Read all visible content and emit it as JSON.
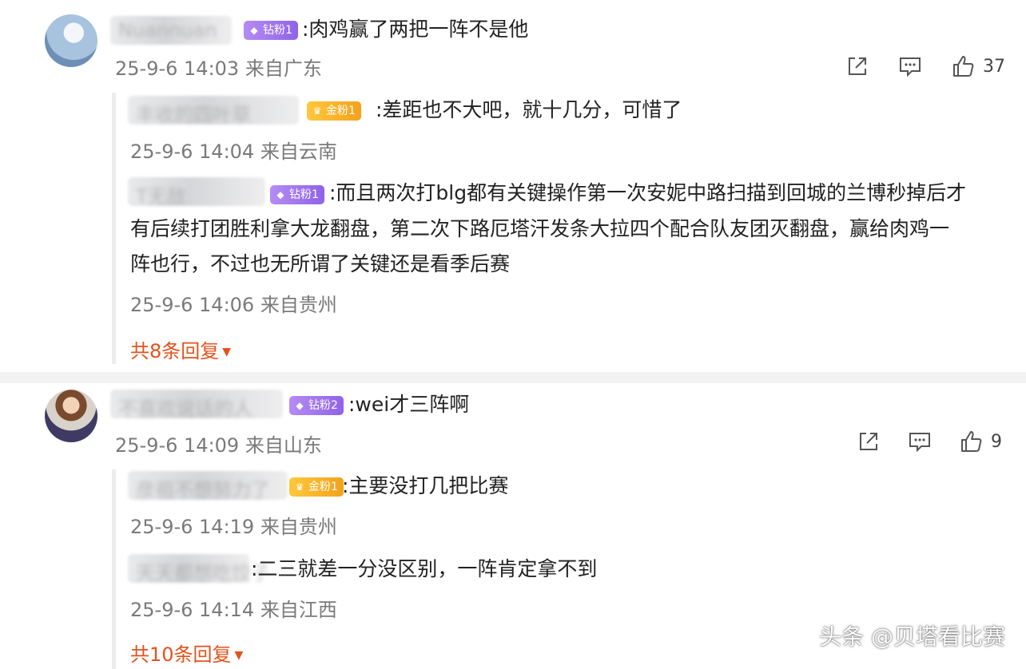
{
  "comments": [
    {
      "username": "Nuannuan",
      "badge": "钻粉1",
      "text": ":肉鸡赢了两把一阵不是他",
      "meta": "25-9-6 14:03 来自广东",
      "likes": "37",
      "replies": [
        {
          "username": "丰收的四叶草",
          "badge": "金粉1",
          "text": ":差距也不大吧，就十几分，可惜了",
          "meta": "25-9-6 14:04 来自云南"
        },
        {
          "username": "T无敌",
          "badge": "钻粉1",
          "text_lines": [
            ":而且两次打blg都有关键操作第一次安妮中路扫描到回城的兰博秒掉后才",
            "有后续打团胜利拿大龙翻盘，第二次下路厄塔汗发条大拉四个配合队友团灭翻盘，赢给肉鸡一",
            "阵也行，不过也无所谓了关键还是看季后赛"
          ],
          "meta": "25-9-6 14:06 来自贵州"
        }
      ],
      "more_replies": "共8条回复"
    },
    {
      "username": "不喜欢说话的人",
      "badge": "钻粉2",
      "text": ":wei才三阵啊",
      "meta": "25-9-6 14:09 来自山东",
      "likes": "9",
      "replies": [
        {
          "username": "彦祖不想努力了",
          "badge": "金粉1",
          "text": ":主要没打几把比赛",
          "meta": "25-9-6 14:19 来自贵州"
        },
        {
          "username": "天天都想吃饺子",
          "badge": "",
          "text": ":二三就差一分没区别，一阵肯定拿不到",
          "meta": "25-9-6 14:14 来自江西"
        }
      ],
      "more_replies": "共10条回复"
    }
  ],
  "watermark": "头条 @贝塔看比赛",
  "colors": {
    "accent": "#e2531b",
    "diamond_badge": "#9b6ff0",
    "gold_badge": "#f5b42a"
  },
  "icons": [
    "share-icon",
    "comment-icon",
    "like-icon"
  ]
}
